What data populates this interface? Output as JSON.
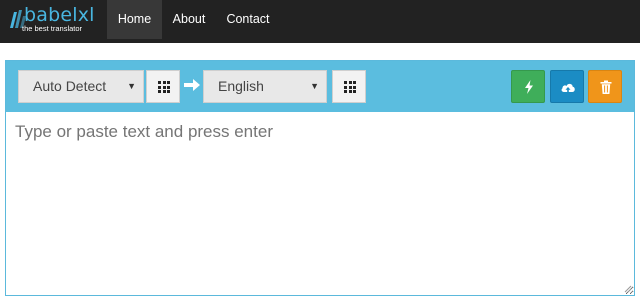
{
  "brand": {
    "name": "babelxl",
    "tagline": "the best translator",
    "color": "#49b6e0"
  },
  "nav": {
    "items": [
      {
        "label": "Home",
        "active": true
      },
      {
        "label": "About",
        "active": false
      },
      {
        "label": "Contact",
        "active": false
      }
    ]
  },
  "toolbar": {
    "source_language": "Auto Detect",
    "target_language": "English",
    "caret_glyph": "▼",
    "icons": [
      "grid-icon",
      "arrow-right-icon",
      "lightning-icon",
      "cloud-upload-icon",
      "trash-icon"
    ],
    "colors": {
      "toolbar_bg": "#5bbddf",
      "lightning_button": "#3fae5a",
      "cloud_button": "#1b8cc4",
      "trash_button": "#f0951a"
    }
  },
  "editor": {
    "placeholder": "Type or paste text and press enter",
    "value": ""
  }
}
